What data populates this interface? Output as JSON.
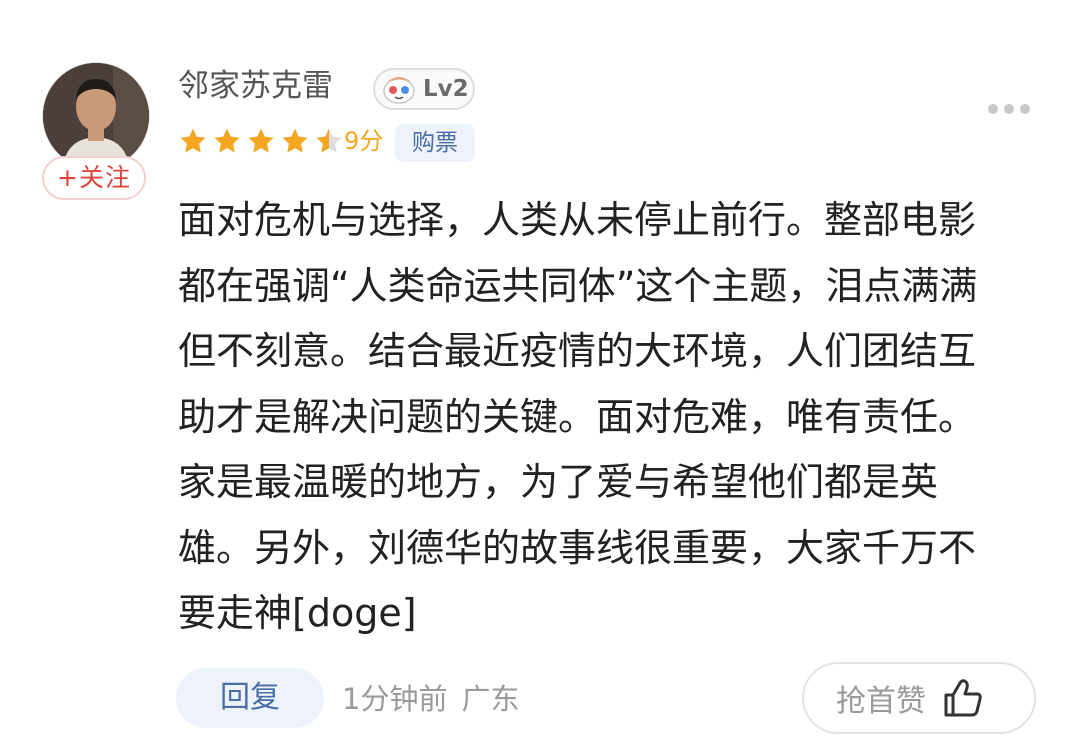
{
  "user": {
    "name": "邻家苏克雷",
    "level": "Lv2",
    "follow_label": "+关注"
  },
  "rating": {
    "score_text": "9分",
    "stars_full": 4,
    "stars_half": 1,
    "tag": "购票"
  },
  "comment": {
    "text": "面对危机与选择，人类从未停止前行。整部电影都在强调“人类命运共同体”这个主题，泪点满满但不刻意。结合最近疫情的大环境，人们团结互助才是解决问题的关键。面对危难，唯有责任。家是最温暖的地方，为了爱与希望他们都是英雄。另外，刘德华的故事线很重要，大家千万不要走神[doge]"
  },
  "footer": {
    "reply_label": "回复",
    "time": "1分钟前",
    "location": "广东",
    "like_label": "抢首赞"
  },
  "icons": {
    "more": "more-dots-icon",
    "like": "thumbs-up-icon",
    "level": "mascot-level-icon",
    "star": "star-icon"
  },
  "colors": {
    "star": "#f5a623",
    "follow": "#e2433a",
    "tag_bg": "#eef3fb",
    "tag_text": "#4a6da7"
  }
}
